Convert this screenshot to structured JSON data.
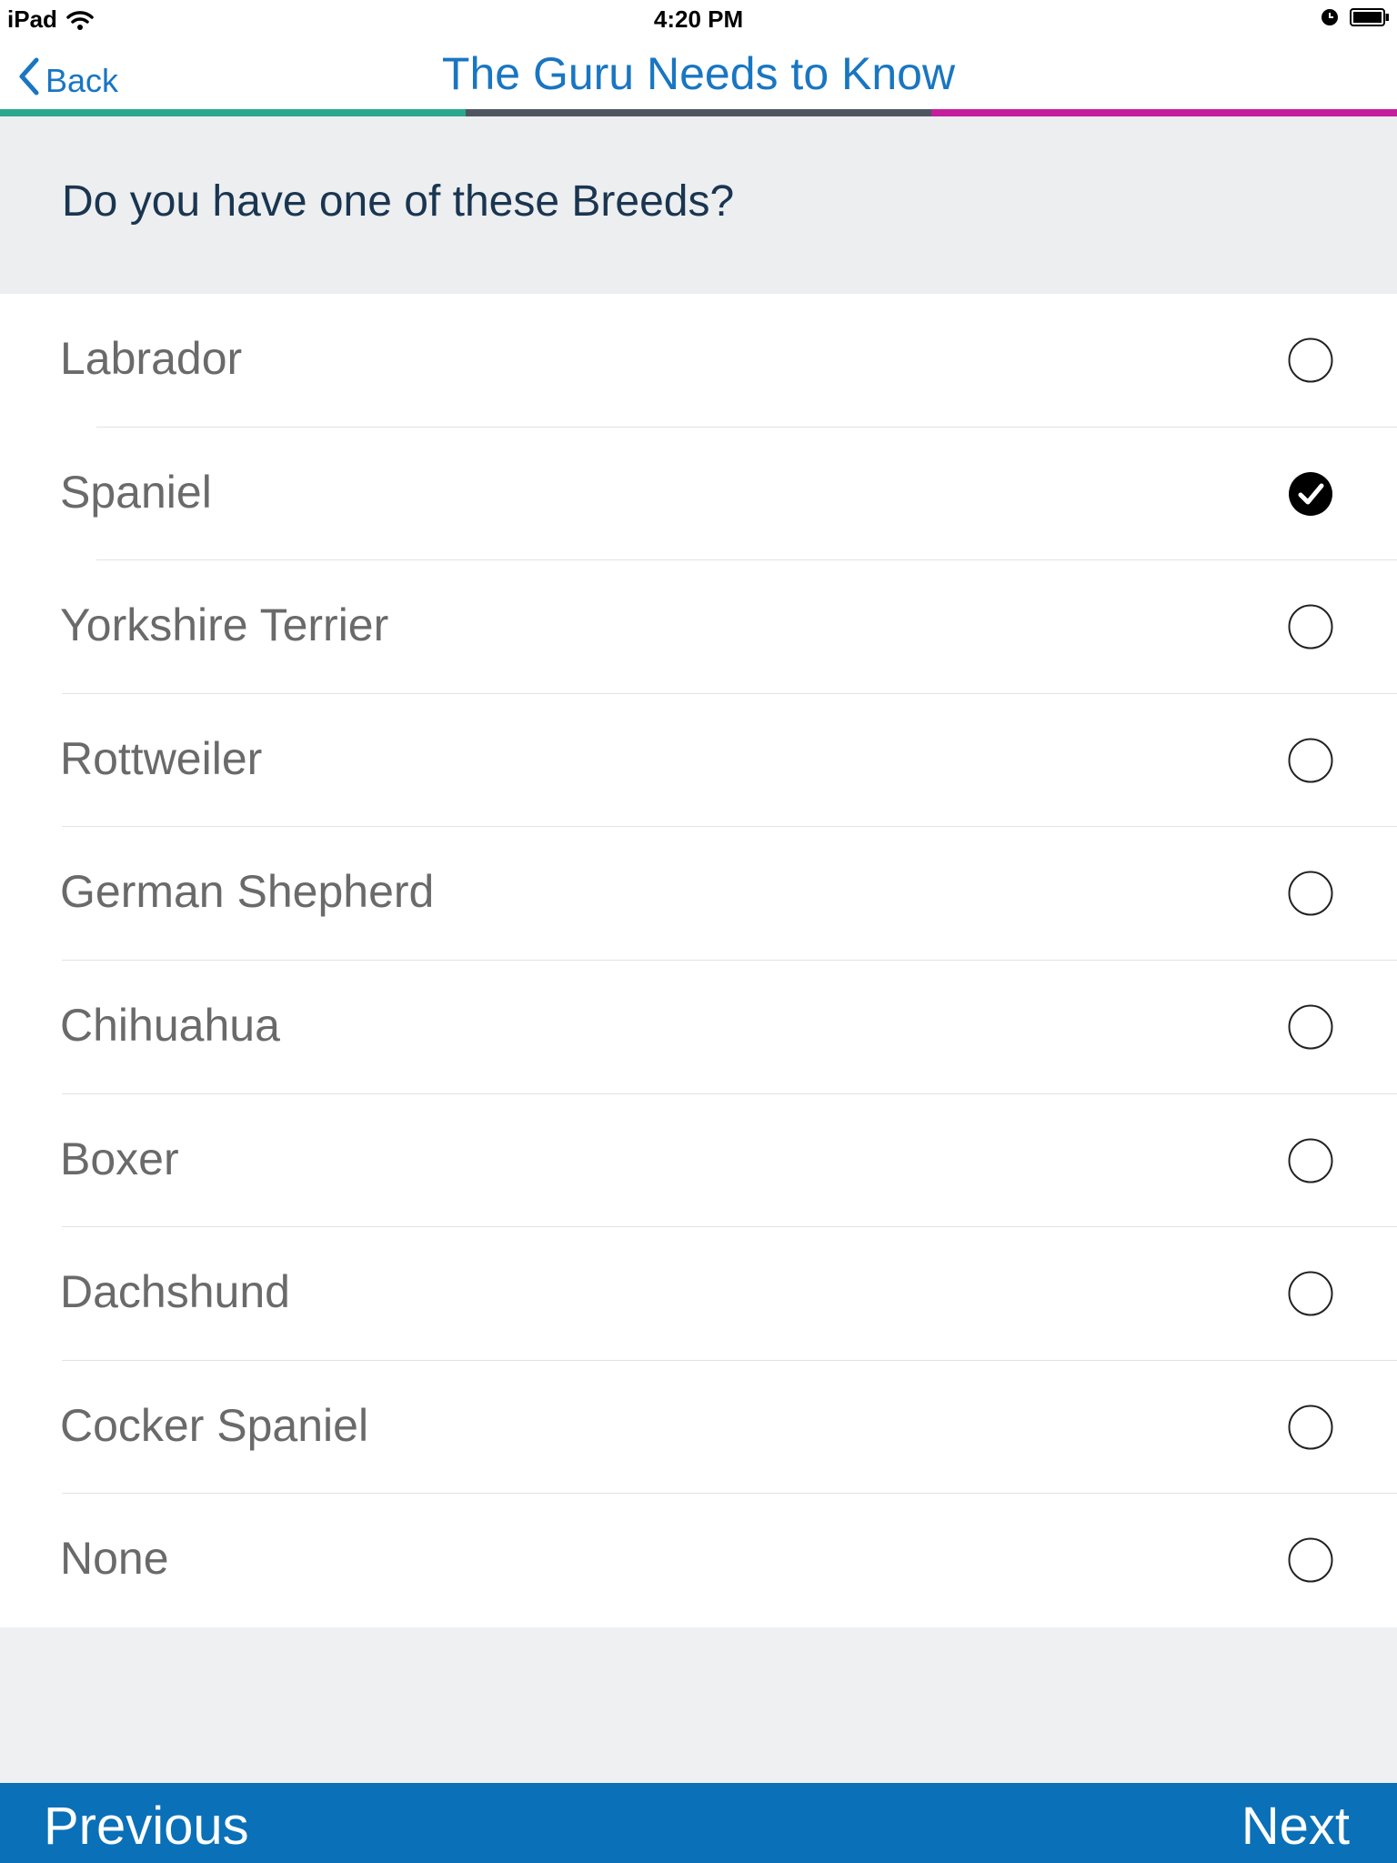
{
  "status_bar": {
    "device": "iPad",
    "time": "4:20 PM"
  },
  "nav": {
    "back_label": "Back",
    "title": "The Guru Needs to Know"
  },
  "progress": {
    "colors": [
      "#2aa88e",
      "#4d5660",
      "#c41e9c"
    ]
  },
  "question": {
    "text": "Do you have one of these Breeds?"
  },
  "breeds": [
    {
      "label": "Labrador",
      "selected": false
    },
    {
      "label": "Spaniel",
      "selected": true
    },
    {
      "label": "Yorkshire Terrier",
      "selected": false
    },
    {
      "label": "Rottweiler",
      "selected": false
    },
    {
      "label": "German Shepherd",
      "selected": false
    },
    {
      "label": "Chihuahua",
      "selected": false
    },
    {
      "label": "Boxer",
      "selected": false
    },
    {
      "label": "Dachshund",
      "selected": false
    },
    {
      "label": "Cocker Spaniel",
      "selected": false
    },
    {
      "label": "None",
      "selected": false
    }
  ],
  "footer": {
    "previous_label": "Previous",
    "next_label": "Next"
  },
  "colors": {
    "accent": "#1976c2",
    "footer": "#0a70b8"
  }
}
